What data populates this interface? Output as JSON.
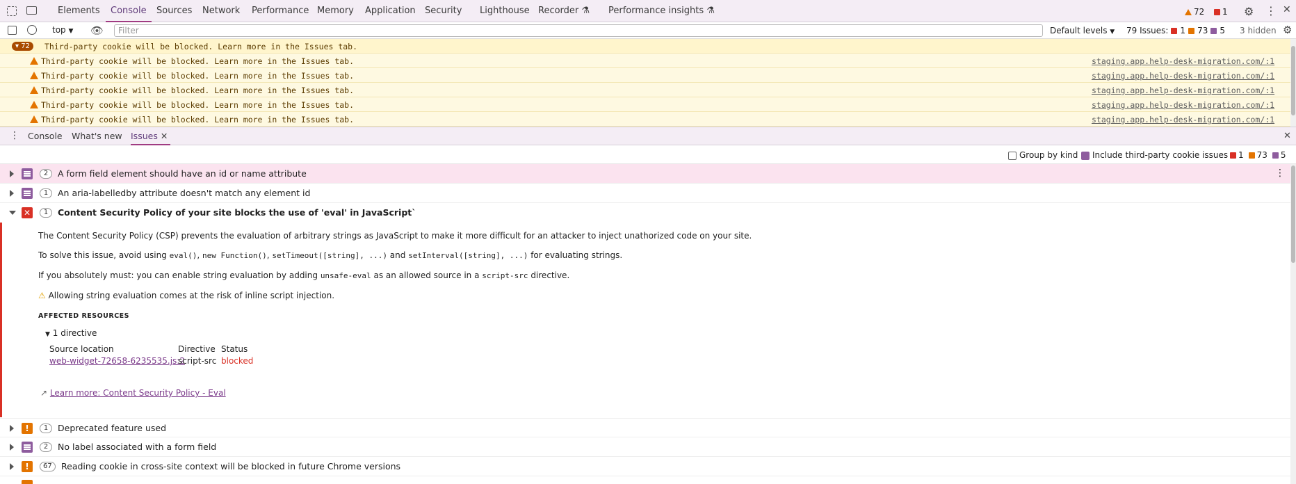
{
  "main_tabs": [
    {
      "label": "Elements"
    },
    {
      "label": "Console"
    },
    {
      "label": "Sources"
    },
    {
      "label": "Network"
    },
    {
      "label": "Performance"
    },
    {
      "label": "Memory"
    },
    {
      "label": "Application"
    },
    {
      "label": "Security"
    },
    {
      "label": "Lighthouse"
    },
    {
      "label": "Recorder"
    },
    {
      "label": "Performance insights"
    }
  ],
  "header_counts": {
    "warnings": "72",
    "errors": "1"
  },
  "toolbar": {
    "context": "top",
    "filter_placeholder": "Filter",
    "levels": "Default levels",
    "issues_label": "79 Issues:",
    "issues_error": "1",
    "issues_warning": "73",
    "issues_info": "5",
    "hidden": "3 hidden"
  },
  "console": {
    "group_count": "72",
    "group_message": "Third-party cookie will be blocked. Learn more in the Issues tab.",
    "rows": [
      {
        "message": "Third-party cookie will be blocked. Learn more in the Issues tab.",
        "source": "staging.app.help-desk-migration.com/:1"
      },
      {
        "message": "Third-party cookie will be blocked. Learn more in the Issues tab.",
        "source": "staging.app.help-desk-migration.com/:1"
      },
      {
        "message": "Third-party cookie will be blocked. Learn more in the Issues tab.",
        "source": "staging.app.help-desk-migration.com/:1"
      },
      {
        "message": "Third-party cookie will be blocked. Learn more in the Issues tab.",
        "source": "staging.app.help-desk-migration.com/:1"
      },
      {
        "message": "Third-party cookie will be blocked. Learn more in the Issues tab.",
        "source": "staging.app.help-desk-migration.com/:1"
      }
    ]
  },
  "drawer_tabs": [
    {
      "label": "Console"
    },
    {
      "label": "What's new"
    },
    {
      "label": "Issues"
    }
  ],
  "issues_toolbar": {
    "group_by_kind": "Group by kind",
    "include_third_party": "Include third-party cookie issues",
    "count_error": "1",
    "count_warning": "73",
    "count_info": "5"
  },
  "issues": [
    {
      "count": "2",
      "title": "A form field element should have an id or name attribute"
    },
    {
      "count": "1",
      "title": "An aria-labelledby attribute doesn't match any element id"
    },
    {
      "count": "1",
      "title": "Content Security Policy of your site blocks the use of 'eval' in JavaScript`"
    },
    {
      "count": "1",
      "title": "Deprecated feature used"
    },
    {
      "count": "2",
      "title": "No label associated with a form field"
    },
    {
      "count": "67",
      "title": "Reading cookie in cross-site context will be blocked in future Chrome versions"
    }
  ],
  "details": {
    "p1": "The Content Security Policy (CSP) prevents the evaluation of arbitrary strings as JavaScript to make it more difficult for an attacker to inject unathorized code on your site.",
    "p2_a": "To solve this issue, avoid using ",
    "p2_c1": "eval()",
    "p2_s1": ", ",
    "p2_c2": "new Function()",
    "p2_s2": ", ",
    "p2_c3": "setTimeout([string], ...)",
    "p2_s3": " and ",
    "p2_c4": "setInterval([string], ...)",
    "p2_b": " for evaluating strings.",
    "p3_a": "If you absolutely must: you can enable string evaluation by adding ",
    "p3_c1": "unsafe-eval",
    "p3_b": " as an allowed source in a ",
    "p3_c2": "script-src",
    "p3_c": " directive.",
    "p4": "Allowing string evaluation comes at the risk of inline script injection.",
    "affected": "AFFECTED RESOURCES",
    "directive_toggle": "1 directive",
    "col_source": "Source location",
    "col_directive": "Directive",
    "col_status": "Status",
    "source_value": "web-widget-72658-6235535.js:2",
    "directive_value": "script-src",
    "status_value": "blocked",
    "learn_more": "Learn more: Content Security Policy - Eval"
  },
  "colors": {
    "accent": "#a03b82",
    "error": "#d93025",
    "warning": "#e37400",
    "link": "#7b3a8a"
  }
}
